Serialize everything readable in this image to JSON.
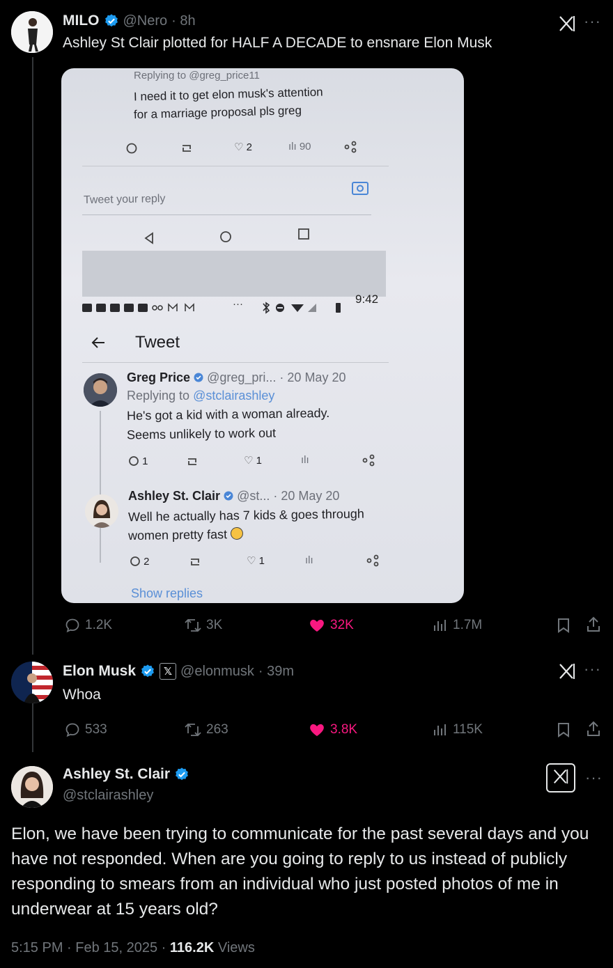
{
  "tweet1": {
    "name": "MILO",
    "handle": "@Nero",
    "time": "· 8h",
    "text": "Ashley St Clair plotted for HALF A DECADE to ensnare Elon Musk",
    "stats": {
      "replies": "1.2K",
      "reposts": "3K",
      "likes": "32K",
      "views": "1.7M"
    }
  },
  "photo": {
    "top_replying": "Replying to @greg_price11",
    "top_text_1": "I need it to get elon musk's attention",
    "top_text_2": "for a marriage proposal pls greg",
    "top_likes": "2",
    "top_views": "90",
    "reply_placeholder": "Tweet your reply",
    "status_time": "9:42",
    "status_more": "···",
    "header": "Tweet",
    "greg": {
      "name": "Greg Price",
      "handle": "@greg_pri...",
      "date": "· 20 May 20",
      "replying": "Replying to ",
      "replying_handle": "@stclairashley",
      "line1": "He's got a kid with a woman already.",
      "line2": "Seems unlikely to work out",
      "replies": "1",
      "likes": "1"
    },
    "ashley": {
      "name": "Ashley St. Clair",
      "handle": "@st...",
      "date": "· 20 May 20",
      "line1": "Well he actually has 7 kids & goes through",
      "line2": "women pretty fast",
      "replies": "2",
      "likes": "1"
    },
    "show_replies": "Show replies"
  },
  "tweet2": {
    "name": "Elon Musk",
    "handle": "@elonmusk",
    "time": "· 39m",
    "text": "Whoa",
    "stats": {
      "replies": "533",
      "reposts": "263",
      "likes": "3.8K",
      "views": "115K"
    }
  },
  "tweet3": {
    "name": "Ashley St. Clair",
    "handle": "@stclairashley",
    "text": "Elon, we have been trying to communicate for the past several days and you have not responded. When are you going to reply to us instead of publicly responding to smears from an individual who just posted photos of me in underwear at 15 years old?",
    "timestamp": "5:15 PM · Feb 15, 2025 · ",
    "views_count": "116.2K",
    "views_label": " Views"
  },
  "colors": {
    "like": "#f91880",
    "verified": "#1d9bf0",
    "text": "#e7e9ea",
    "muted": "#71767b"
  },
  "icons": [
    "grok-icon",
    "more-icon",
    "reply-icon",
    "repost-icon",
    "like-icon",
    "views-icon",
    "bookmark-icon",
    "share-icon",
    "verified-icon"
  ]
}
